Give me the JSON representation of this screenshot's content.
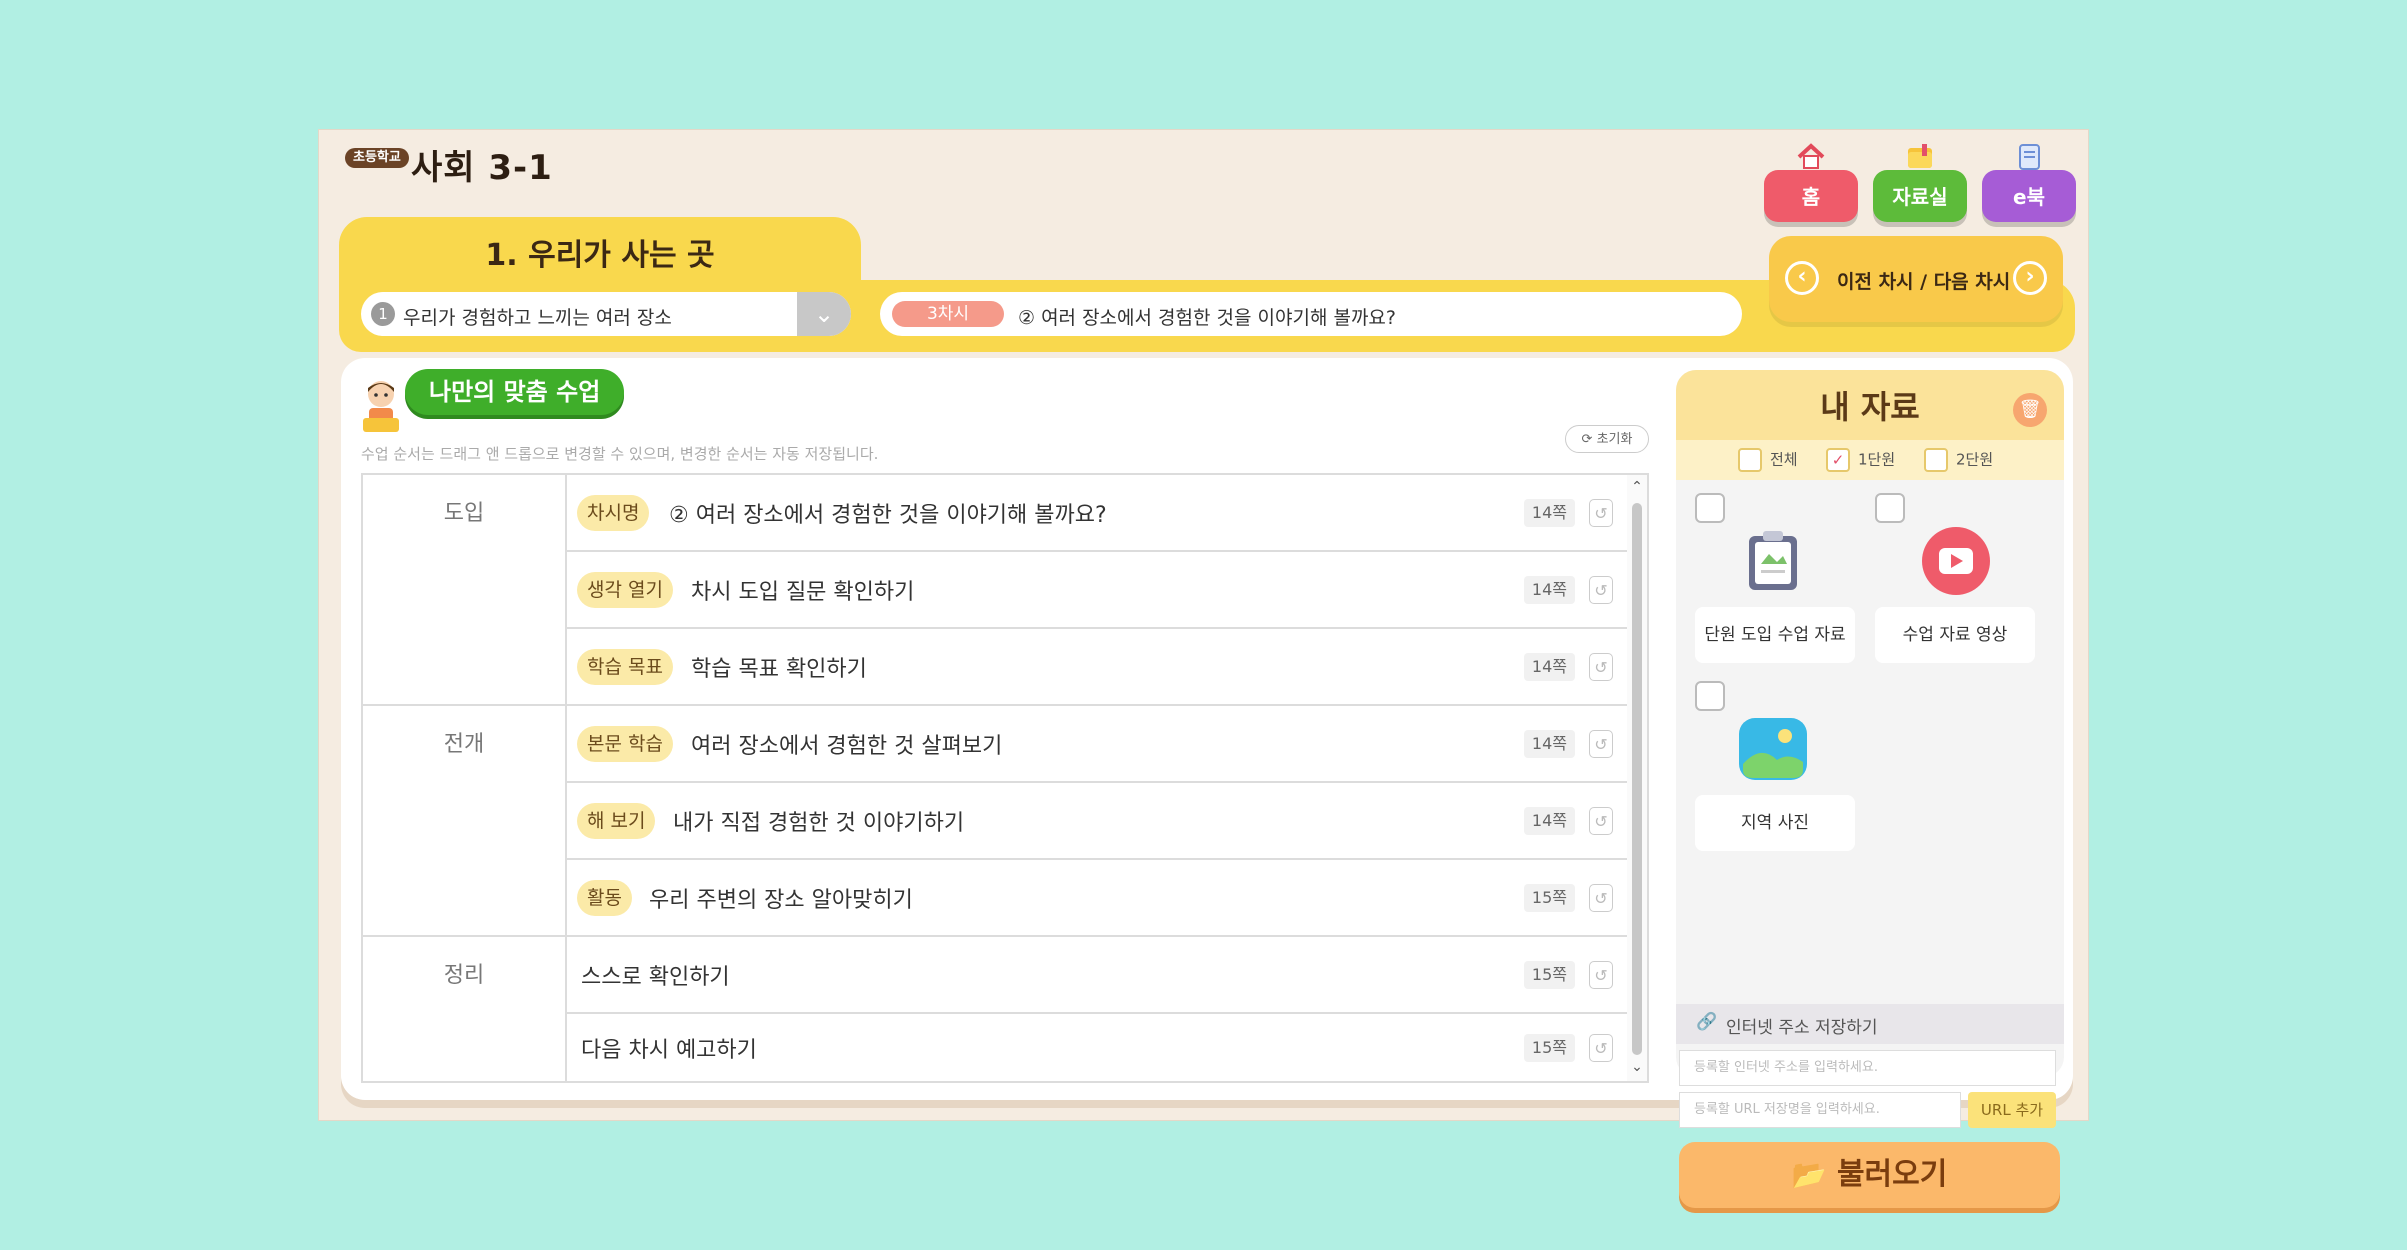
{
  "header": {
    "school_badge": "초등학교",
    "title": "사회 3-1",
    "buttons": {
      "home": "홈",
      "library": "자료실",
      "ebook": "e북"
    }
  },
  "unit": {
    "title": "1. 우리가 사는 곳",
    "sub_number": "1",
    "sub_title": "우리가 경험하고 느끼는 여러 장소",
    "lesson_badge": "3차시",
    "lesson_title": "② 여러 장소에서 경험한 것을 이야기해 볼까요?",
    "nav_label": "이전 차시 / 다음 차시"
  },
  "custom": {
    "title": "나만의 맞춤 수업",
    "hint": "수업 순서는 드래그 앤 드롭으로 변경할 수 있으며, 변경한 순서는 자동 저장됩니다.",
    "reset_label": "초기화"
  },
  "stages": [
    {
      "label": "도입"
    },
    {
      "label": "전개"
    },
    {
      "label": "정리"
    }
  ],
  "rows": [
    {
      "tag": "차시명",
      "text": "② 여러 장소에서 경험한 것을 이야기해 볼까요?",
      "page": "14쪽"
    },
    {
      "tag": "생각 열기",
      "text": "차시 도입 질문 확인하기",
      "page": "14쪽"
    },
    {
      "tag": "학습 목표",
      "text": "학습 목표 확인하기",
      "page": "14쪽"
    },
    {
      "tag": "본문 학습",
      "text": "여러 장소에서 경험한 것 살펴보기",
      "page": "14쪽"
    },
    {
      "tag": "해 보기",
      "text": "내가 직접 경험한 것 이야기하기",
      "page": "14쪽"
    },
    {
      "tag": "활동",
      "text": "우리 주변의 장소 알아맞히기",
      "page": "15쪽"
    },
    {
      "tag": "",
      "text": "스스로 확인하기",
      "page": "15쪽"
    },
    {
      "tag": "",
      "text": "다음 차시 예고하기",
      "page": "15쪽"
    }
  ],
  "materials": {
    "title": "내 자료",
    "filters": [
      {
        "label": "전체",
        "checked": false
      },
      {
        "label": "1단원",
        "checked": true
      },
      {
        "label": "2단원",
        "checked": false
      }
    ],
    "cards": [
      {
        "label": "단원 도입 수업 자료",
        "icon": "clipboard-icon"
      },
      {
        "label": "수업 자료 영상",
        "icon": "video-play-icon"
      },
      {
        "label": "지역 사진",
        "icon": "image-icon"
      }
    ],
    "url_title": "인터넷 주소 저장하기",
    "url_placeholder": "등록할 인터넷 주소를 입력하세요.",
    "name_placeholder": "등록할 URL 저장명을 입력하세요.",
    "url_add": "URL 추가",
    "load_label": "불러오기"
  },
  "colors": {
    "background": "#b1efe3",
    "accent_yellow": "#f9d84d",
    "green": "#3fae2a",
    "load_orange": "#fbb86a"
  }
}
